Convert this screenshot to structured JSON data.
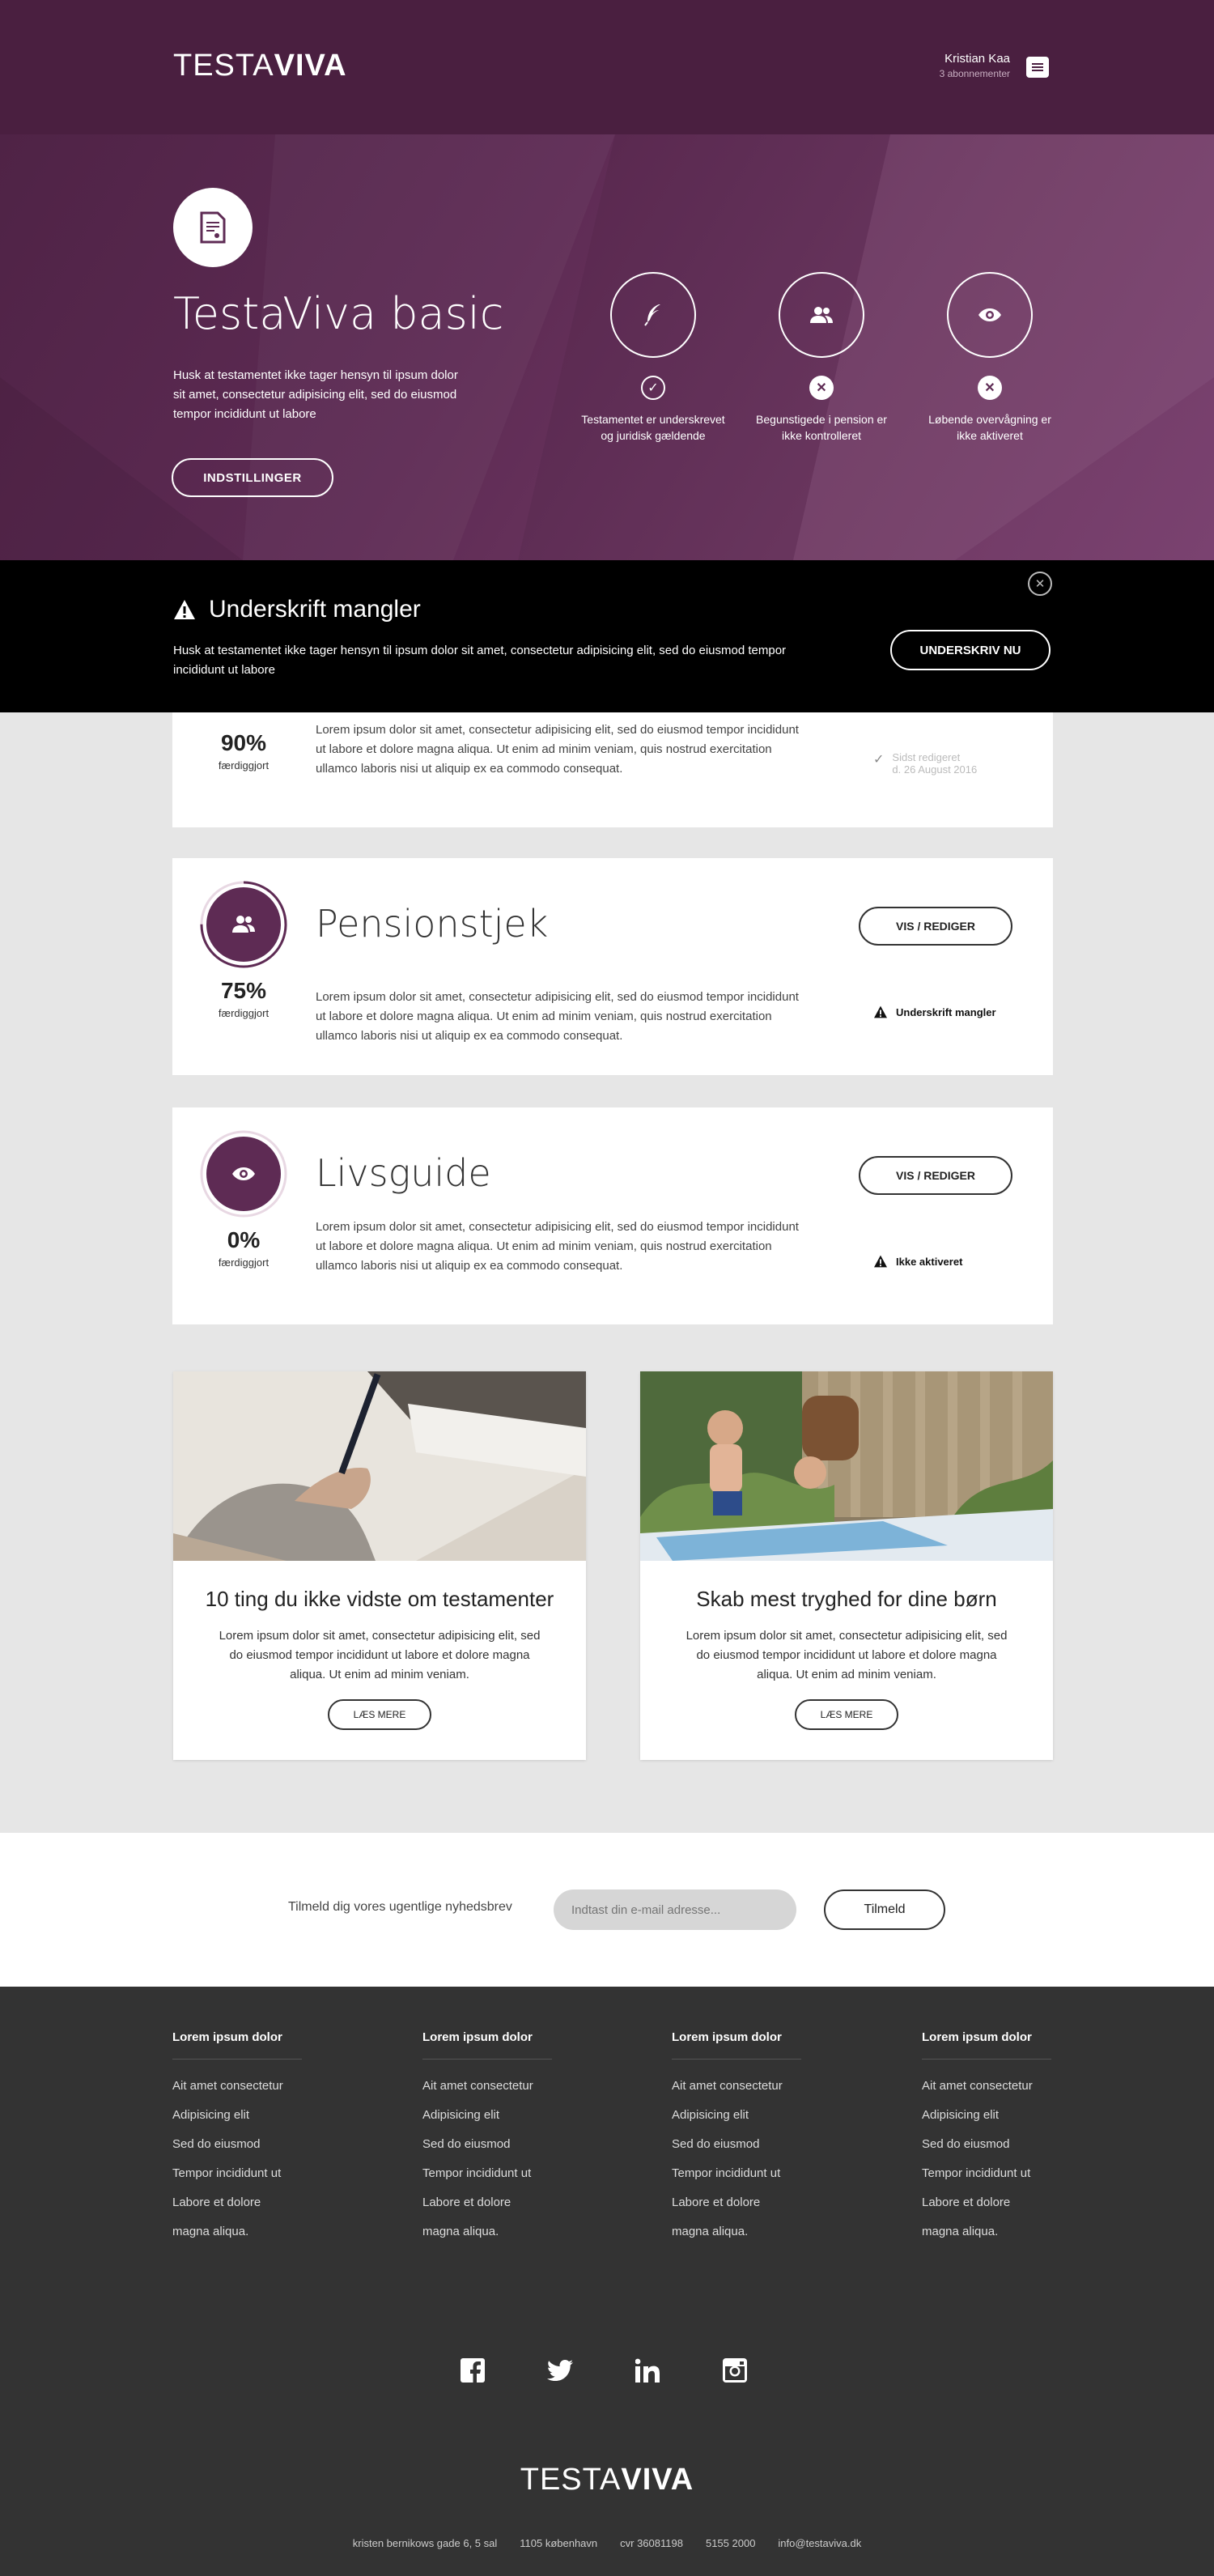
{
  "header": {
    "logo_light": "TESTA",
    "logo_bold": "VIVA",
    "user_name": "Kristian Kaa",
    "user_subscriptions": "3 abonnementer"
  },
  "hero": {
    "title": "TestaViva basic",
    "text": "Husk at testamentet ikke tager hensyn til ipsum dolor sit amet, consectetur adipisicing elit, sed do eiusmod tempor incididunt ut labore",
    "settings_button": "INDSTILLINGER",
    "features": [
      {
        "icon": "feather-icon",
        "status": "ok",
        "label": "Testamentet er underskrevet og juridisk gældende"
      },
      {
        "icon": "users-icon",
        "status": "missing",
        "label": "Begunstigede i pension er ikke kontrolleret"
      },
      {
        "icon": "eye-icon",
        "status": "missing",
        "label": "Løbende overvågning er ikke aktiveret"
      }
    ]
  },
  "alert": {
    "title": "Underskrift mangler",
    "text": "Husk at testamentet ikke tager hensyn til ipsum dolor sit amet, consectetur adipisicing elit, sed do eiusmod tempor incididunt ut labore",
    "sign_button": "UNDERSKRIV NU"
  },
  "cards": [
    {
      "title": "",
      "percent": "90%",
      "progress": 0.9,
      "percent_label": "færdiggjort",
      "text": "Lorem ipsum dolor sit amet, consectetur adipisicing elit, sed do eiusmod tempor incididunt ut labore et dolore magna aliqua. Ut enim ad minim veniam, quis nostrud exercitation ullamco laboris nisi ut aliquip ex ea commodo consequat.",
      "edited_label": "Sidst redigeret",
      "edited_date": "d. 26 August 2016"
    },
    {
      "title": "Pensionstjek",
      "percent": "75%",
      "progress": 0.75,
      "percent_label": "færdiggjort",
      "text": "Lorem ipsum dolor sit amet, consectetur adipisicing elit, sed do eiusmod tempor incididunt ut labore et dolore magna aliqua. Ut enim ad minim veniam, quis nostrud exercitation ullamco laboris nisi ut aliquip ex ea commodo consequat.",
      "button": "VIS / REDIGER",
      "status": "Underskrift mangler"
    },
    {
      "title": "Livsguide",
      "percent": "0%",
      "progress": 0,
      "percent_label": "færdiggjort",
      "text": "Lorem ipsum dolor sit amet, consectetur adipisicing elit, sed do eiusmod tempor incididunt ut labore et dolore magna aliqua. Ut enim ad minim veniam, quis nostrud exercitation ullamco laboris nisi ut aliquip ex ea commodo consequat.",
      "button": "VIS / REDIGER",
      "status": "Ikke aktiveret"
    }
  ],
  "articles": [
    {
      "title": "10 ting du ikke vidste om testamenter",
      "text": "Lorem ipsum dolor sit amet, consectetur adipisicing elit, sed do eiusmod tempor incididunt ut labore et dolore magna aliqua. Ut enim ad minim veniam.",
      "button": "LÆS MERE"
    },
    {
      "title": "Skab mest tryghed for dine børn",
      "text": "Lorem ipsum dolor sit amet, consectetur adipisicing elit, sed do eiusmod tempor incididunt ut labore et dolore magna aliqua. Ut enim ad minim veniam.",
      "button": "LÆS MERE"
    }
  ],
  "newsletter": {
    "label": "Tilmeld dig vores ugentlige nyhedsbrev",
    "placeholder": "Indtast din e-mail adresse...",
    "button": "Tilmeld"
  },
  "footer": {
    "columns": [
      {
        "heading": "Lorem ipsum dolor",
        "links": [
          "Ait amet consectetur",
          "Adipisicing elit",
          "Sed do eiusmod",
          "Tempor incididunt ut",
          "Labore et dolore",
          "magna aliqua."
        ]
      },
      {
        "heading": "Lorem ipsum dolor",
        "links": [
          "Ait amet consectetur",
          "Adipisicing elit",
          "Sed do eiusmod",
          "Tempor incididunt ut",
          "Labore et dolore",
          "magna aliqua."
        ]
      },
      {
        "heading": "Lorem ipsum dolor",
        "links": [
          "Ait amet consectetur",
          "Adipisicing elit",
          "Sed do eiusmod",
          "Tempor incididunt ut",
          "Labore et dolore",
          "magna aliqua."
        ]
      },
      {
        "heading": "Lorem ipsum dolor",
        "links": [
          "Ait amet consectetur",
          "Adipisicing elit",
          "Sed do eiusmod",
          "Tempor incididunt ut",
          "Labore et dolore",
          "magna aliqua."
        ]
      }
    ],
    "social": [
      "facebook-icon",
      "twitter-icon",
      "linkedin-icon",
      "instagram-icon"
    ],
    "logo_light": "TESTA",
    "logo_bold": "VIVA",
    "address": "kristen bernikows gade 6, 5 sal",
    "city": "1105 københavn",
    "cvr": "cvr 36081198",
    "phone": "5155 2000",
    "email": "info@testaviva.dk"
  },
  "colors": {
    "brand_purple": "#5e2b54",
    "header_dark": "#4a1f40",
    "footer_dark": "#333333",
    "alert_black": "#000000"
  }
}
